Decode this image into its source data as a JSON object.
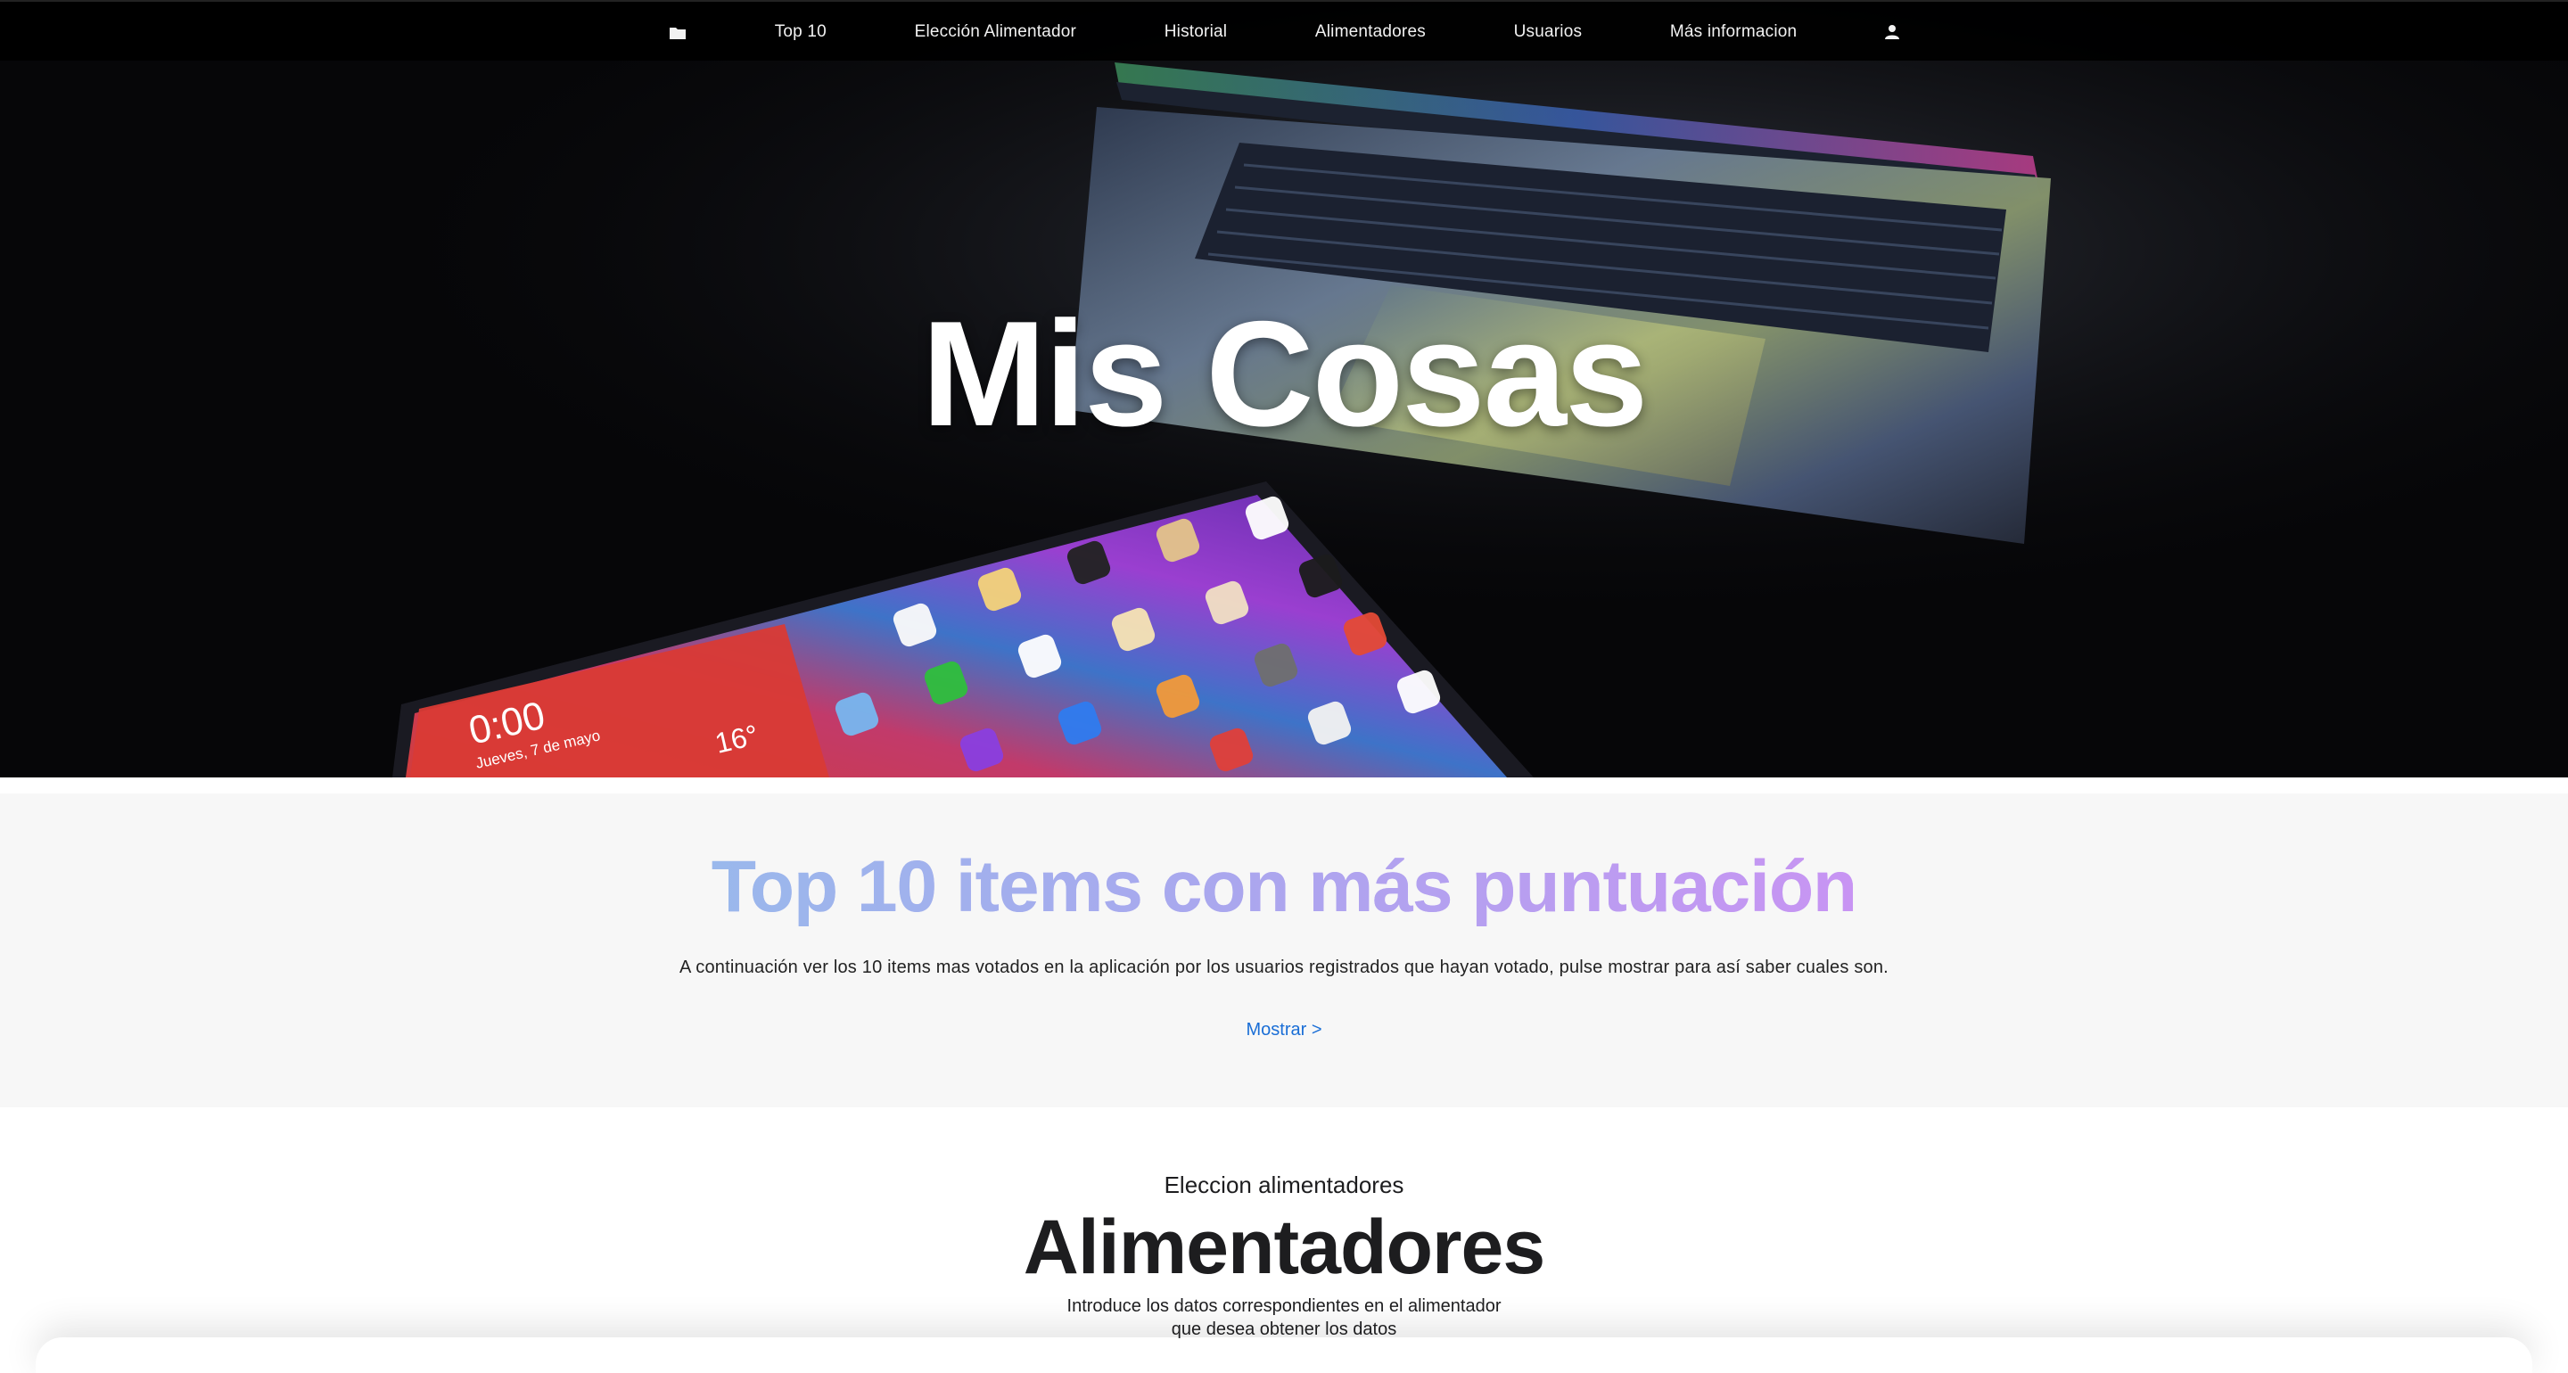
{
  "nav": {
    "folder_icon": "folder-icon",
    "items": [
      {
        "label": "Top 10"
      },
      {
        "label": "Elección Alimentador"
      },
      {
        "label": "Historial"
      },
      {
        "label": "Alimentadores"
      },
      {
        "label": "Usuarios"
      },
      {
        "label": "Más informacion"
      }
    ],
    "user_icon": "user-icon"
  },
  "hero": {
    "title": "Mis Cosas",
    "tablet_time": "0:00",
    "tablet_date": "Jueves, 7 de mayo",
    "tablet_temp": "16°"
  },
  "top10": {
    "title": "Top 10 items con más puntuación",
    "description": "A continuación ver los 10 items mas votados en la aplicación por los usuarios registrados que hayan votado, pulse mostrar para así saber cuales son.",
    "link": "Mostrar >"
  },
  "alimentadores": {
    "kicker": "Eleccion alimentadores",
    "title": "Alimentadores",
    "description_line1": "Introduce los datos correspondientes en el alimentador",
    "description_line2": "que desea obtener los datos"
  },
  "colors": {
    "nav_bg": "#000000",
    "gradient_start": "#9ab8ec",
    "gradient_end": "#c895f2",
    "link": "#1a6ed6"
  }
}
